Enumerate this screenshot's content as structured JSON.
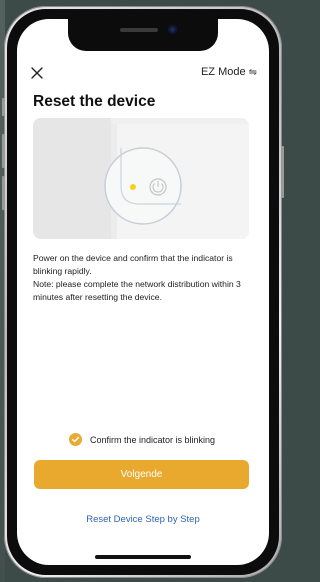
{
  "header": {
    "mode_label": "EZ Mode"
  },
  "title": "Reset the device",
  "description": {
    "line1": "Power on the device and confirm that the indicator is blinking rapidly.",
    "line2": "Note: please complete the network distribution within 3 minutes after resetting the device."
  },
  "confirm": {
    "label": "Confirm the indicator is blinking",
    "checked": true
  },
  "primary_button": {
    "label": "Volgende"
  },
  "secondary_link": {
    "label": "Reset Device Step by Step"
  },
  "colors": {
    "accent": "#e8a92e",
    "link": "#2f63b6",
    "indicator_led": "#f0d21c"
  },
  "icons": {
    "close": "close-icon",
    "mode_switch": "swap-icon",
    "checkbox": "check-icon",
    "power": "power-icon"
  }
}
